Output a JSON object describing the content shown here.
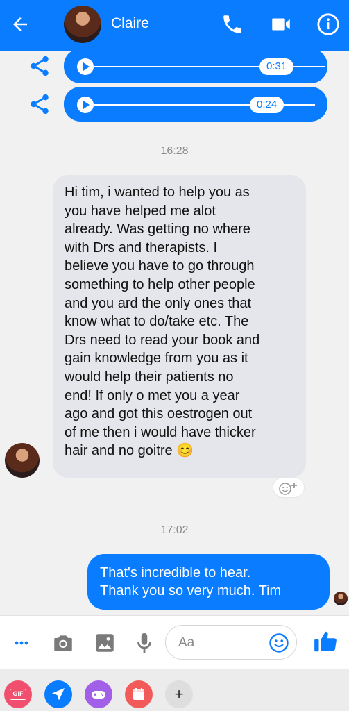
{
  "header": {
    "title": "Claire"
  },
  "messages": {
    "audio": [
      {
        "duration": "0:31"
      },
      {
        "duration": "0:24"
      }
    ],
    "timestamp_1": "16:28",
    "incoming_lines": [
      "Hi tim, i wanted to help you as",
      "you have helped me alot",
      "already. Was getting no where",
      "with Drs and therapists. I",
      "believe you have to go through",
      "something to help other people",
      "and you ard the only ones that",
      "know what to do/take etc.  The",
      "Drs need to read your book and",
      "gain knowledge from you as it",
      "would help their patients no",
      "end! If only o met you a year",
      "ago and got this oestrogen out",
      "of me then i would have thicker",
      "hair and no goitre"
    ],
    "incoming_emoji": "😊",
    "timestamp_2": "17:02",
    "outgoing_lines": [
      "That's incredible to hear.",
      "Thank you so very much. Tim"
    ]
  },
  "composer": {
    "placeholder": "Aa"
  },
  "tray": {
    "gif_label": "GIF",
    "more_label": "+"
  },
  "colors": {
    "brand": "#0a7cff",
    "gif": "#f0506e",
    "location": "#0a7cff",
    "games": "#a25fe8",
    "calendar": "#f25a5a"
  }
}
